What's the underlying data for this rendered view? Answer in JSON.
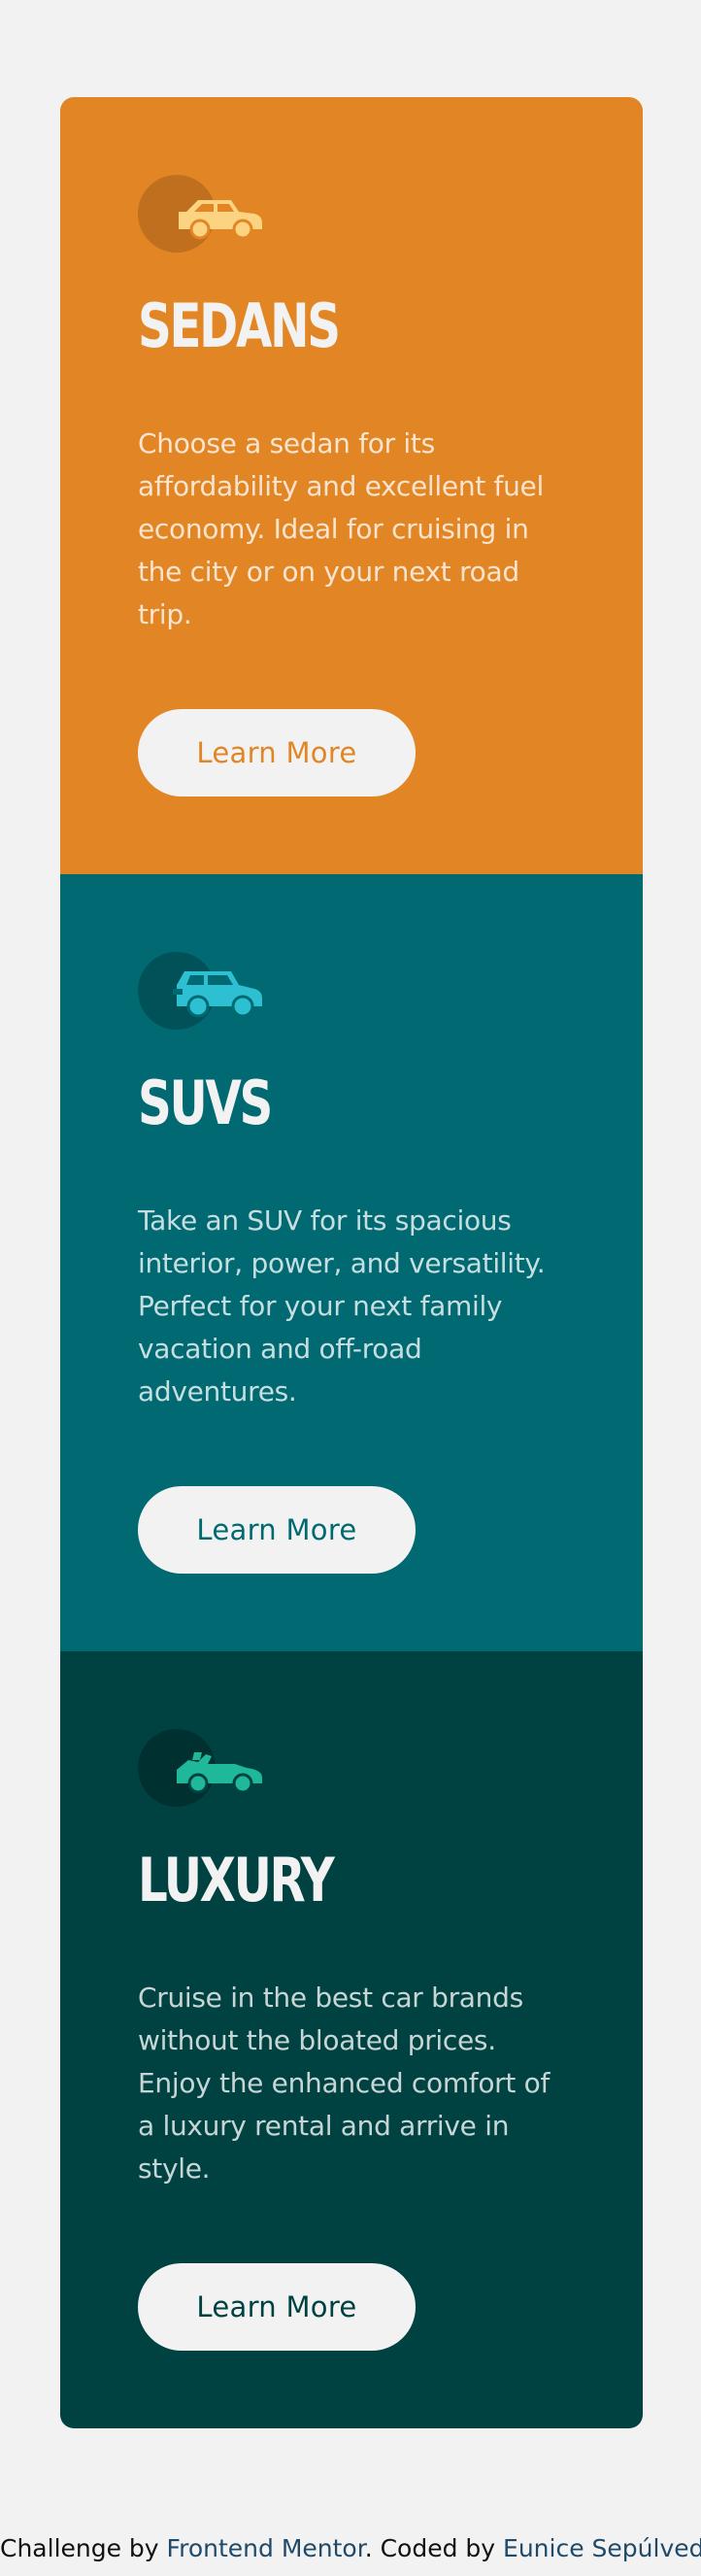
{
  "colors": {
    "page_bg": "#f2f2f2",
    "sedans": "#e28625",
    "suvs": "#006971",
    "luxury": "#004241",
    "text_light": "#f2f2f2"
  },
  "cards": [
    {
      "icon": "sedan-car-icon",
      "title": "Sedans",
      "description": "Choose a sedan for its affordability and excellent fuel economy. Ideal for cruising in the city or on your next road trip.",
      "button_label": "Learn More"
    },
    {
      "icon": "suv-car-icon",
      "title": "SUVs",
      "description": "Take an SUV for its spacious interior, power, and versatility. Perfect for your next family vacation and off-road adventures.",
      "button_label": "Learn More"
    },
    {
      "icon": "luxury-convertible-car-icon",
      "title": "Luxury",
      "description": "Cruise in the best car brands without the bloated prices. Enjoy the enhanced comfort of a luxury rental and arrive in style.",
      "button_label": "Learn More"
    }
  ],
  "footer": {
    "prefix": "Challenge by ",
    "challenge_link": "Frontend Mentor",
    "middle": ". Coded by ",
    "author_link": "Eunice Sepúlveda",
    "suffix": "."
  }
}
